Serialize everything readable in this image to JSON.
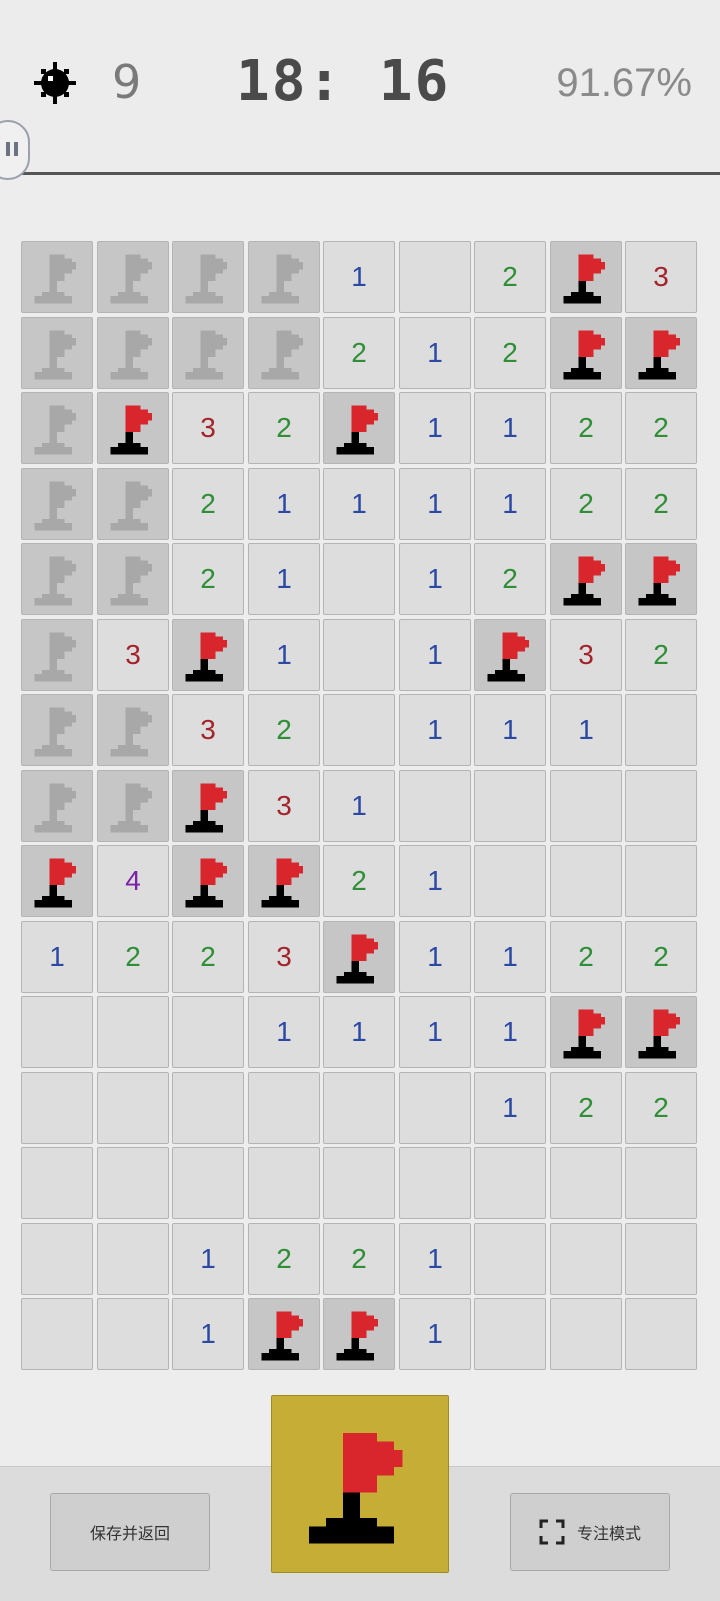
{
  "header": {
    "mine_icon": "mine-icon",
    "mines_remaining": "9",
    "timer": "18: 16",
    "progress": "91.67%"
  },
  "board": {
    "columns": 9,
    "rows": 15,
    "legend": {
      "F": "flag (placed)",
      "G": "flag (greyed)",
      "E": "empty revealed",
      "1-4": "number"
    },
    "cells": [
      [
        "G",
        "G",
        "G",
        "G",
        "1",
        "E",
        "2",
        "F",
        "3"
      ],
      [
        "G",
        "G",
        "G",
        "G",
        "2",
        "1",
        "2",
        "F",
        "F"
      ],
      [
        "G",
        "F",
        "3",
        "2",
        "F",
        "1",
        "1",
        "2",
        "2"
      ],
      [
        "G",
        "G",
        "2",
        "1",
        "1",
        "1",
        "1",
        "2",
        "2"
      ],
      [
        "G",
        "G",
        "2",
        "1",
        "E",
        "1",
        "2",
        "F",
        "F"
      ],
      [
        "G",
        "3",
        "F",
        "1",
        "E",
        "1",
        "F",
        "3",
        "2"
      ],
      [
        "G",
        "G",
        "3",
        "2",
        "E",
        "1",
        "1",
        "1",
        "E"
      ],
      [
        "G",
        "G",
        "F",
        "3",
        "1",
        "E",
        "E",
        "E",
        "E"
      ],
      [
        "F",
        "4",
        "F",
        "F",
        "2",
        "1",
        "E",
        "E",
        "E"
      ],
      [
        "1",
        "2",
        "2",
        "3",
        "F",
        "1",
        "1",
        "2",
        "2"
      ],
      [
        "E",
        "E",
        "E",
        "1",
        "1",
        "1",
        "1",
        "F",
        "F"
      ],
      [
        "E",
        "E",
        "E",
        "E",
        "E",
        "E",
        "1",
        "2",
        "2"
      ],
      [
        "E",
        "E",
        "E",
        "E",
        "E",
        "E",
        "E",
        "E",
        "E"
      ],
      [
        "E",
        "E",
        "1",
        "2",
        "2",
        "1",
        "E",
        "E",
        "E"
      ],
      [
        "E",
        "E",
        "1",
        "F",
        "F",
        "1",
        "E",
        "E",
        "E"
      ]
    ]
  },
  "colors": {
    "number_1": "#2b49a3",
    "number_2": "#2e8f36",
    "number_3": "#a3232a",
    "number_4": "#7a22a8",
    "flag_red": "#d8262c",
    "flag_grey": "#a8a8a8",
    "mode_button_bg": "#c6ad36"
  },
  "bottom": {
    "save_return_label": "保存并返回",
    "focus_mode_label": "专注模式",
    "focus_mode_icon": "fullscreen-icon",
    "mode_toggle_icon": "flag-icon"
  }
}
